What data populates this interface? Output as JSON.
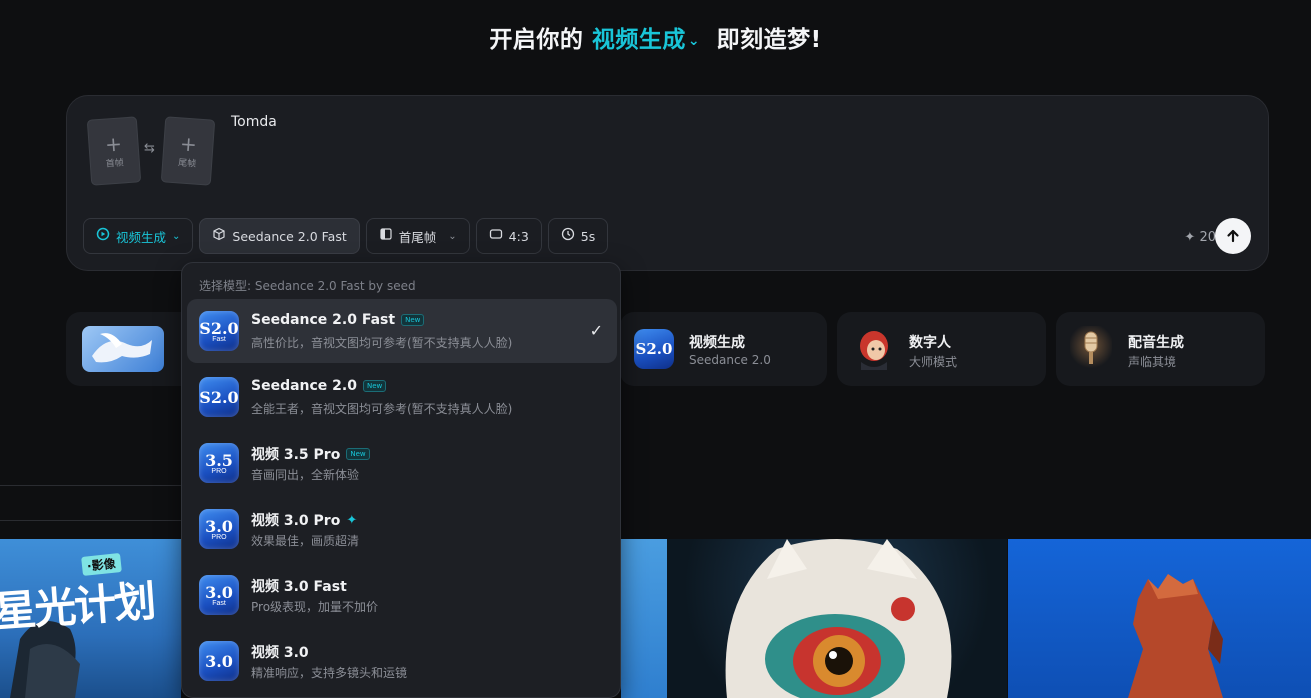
{
  "headline": {
    "prefix": "开启你的",
    "mode": "视频生成",
    "mode_chevron": "chevron-down-icon",
    "suffix": "即刻造梦!"
  },
  "composer": {
    "first_frame_label": "首帧",
    "last_frame_label": "尾帧",
    "prompt_text": "Tomda",
    "toolbar": {
      "mode_label": "视频生成",
      "model_label": "Seedance 2.0 Fast",
      "frame_mode_label": "首尾帧",
      "ratio_label": "4:3",
      "duration_label": "5s"
    },
    "credits": "20"
  },
  "feature_cards": [
    {
      "title": "视频生成",
      "subtitle": "Seedance 2.0"
    },
    {
      "title": "数字人",
      "subtitle": "大师模式"
    },
    {
      "title": "配音生成",
      "subtitle": "声临其境"
    }
  ],
  "dropdown": {
    "header": "选择模型: Seedance 2.0 Fast by seed",
    "new_badge": "New",
    "models": [
      {
        "icon_text": "S2.0",
        "icon_tag": "Fast",
        "name": "Seedance 2.0 Fast",
        "badge": "new",
        "desc": "高性价比，音视文图均可参考(暂不支持真人人脸)",
        "selected": true
      },
      {
        "icon_text": "S2.0",
        "icon_tag": "",
        "name": "Seedance 2.0",
        "badge": "new",
        "desc": "全能王者，音视文图均可参考(暂不支持真人人脸)",
        "selected": false
      },
      {
        "icon_text": "3.5",
        "icon_tag": "PRO",
        "name": "视频 3.5 Pro",
        "badge": "new",
        "desc": "音画同出，全新体验",
        "selected": false
      },
      {
        "icon_text": "3.0",
        "icon_tag": "PRO",
        "name": "视频 3.0 Pro",
        "badge": "spark",
        "desc": "效果最佳，画质超清",
        "selected": false
      },
      {
        "icon_text": "3.0",
        "icon_tag": "Fast",
        "name": "视频 3.0 Fast",
        "badge": "",
        "desc": "Pro级表现，加量不加价",
        "selected": false
      },
      {
        "icon_text": "3.0",
        "icon_tag": "",
        "name": "视频 3.0",
        "badge": "",
        "desc": "精准响应，支持多镜头和运镜",
        "selected": false
      }
    ]
  },
  "gallery": {
    "tile1_text": "星光计划",
    "tile1_tag": "·影像"
  },
  "colors": {
    "accent": "#19c5d8",
    "background": "#0e0f11",
    "card": "#1b1d22"
  }
}
